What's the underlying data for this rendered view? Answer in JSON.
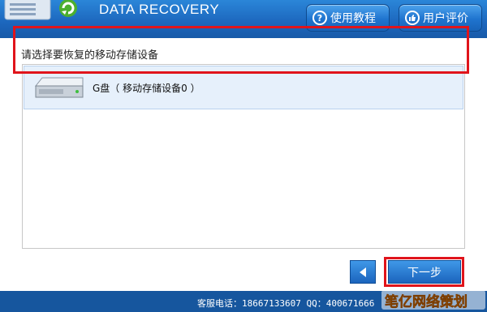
{
  "header": {
    "app_title": "DATA RECOVERY",
    "tutorial_button": "使用教程",
    "review_button": "用户评价"
  },
  "main": {
    "prompt": "请选择要恢复的移动存储设备",
    "devices": [
      {
        "label": "G盘（ 移动存储设备0 ）",
        "icon": "hard-drive-icon"
      }
    ]
  },
  "nav": {
    "next_label": "下一步",
    "back_icon": "triangle-left-icon"
  },
  "footer": {
    "hotline": "客服电话：18667133607  QQ：400671666"
  },
  "watermark": {
    "text": "笔亿网络策划"
  },
  "colors": {
    "header_blue": "#1c66bd",
    "button_blue": "#1f74cf",
    "highlight_red": "#e0141b",
    "selected_row": "#e6f0fb"
  }
}
